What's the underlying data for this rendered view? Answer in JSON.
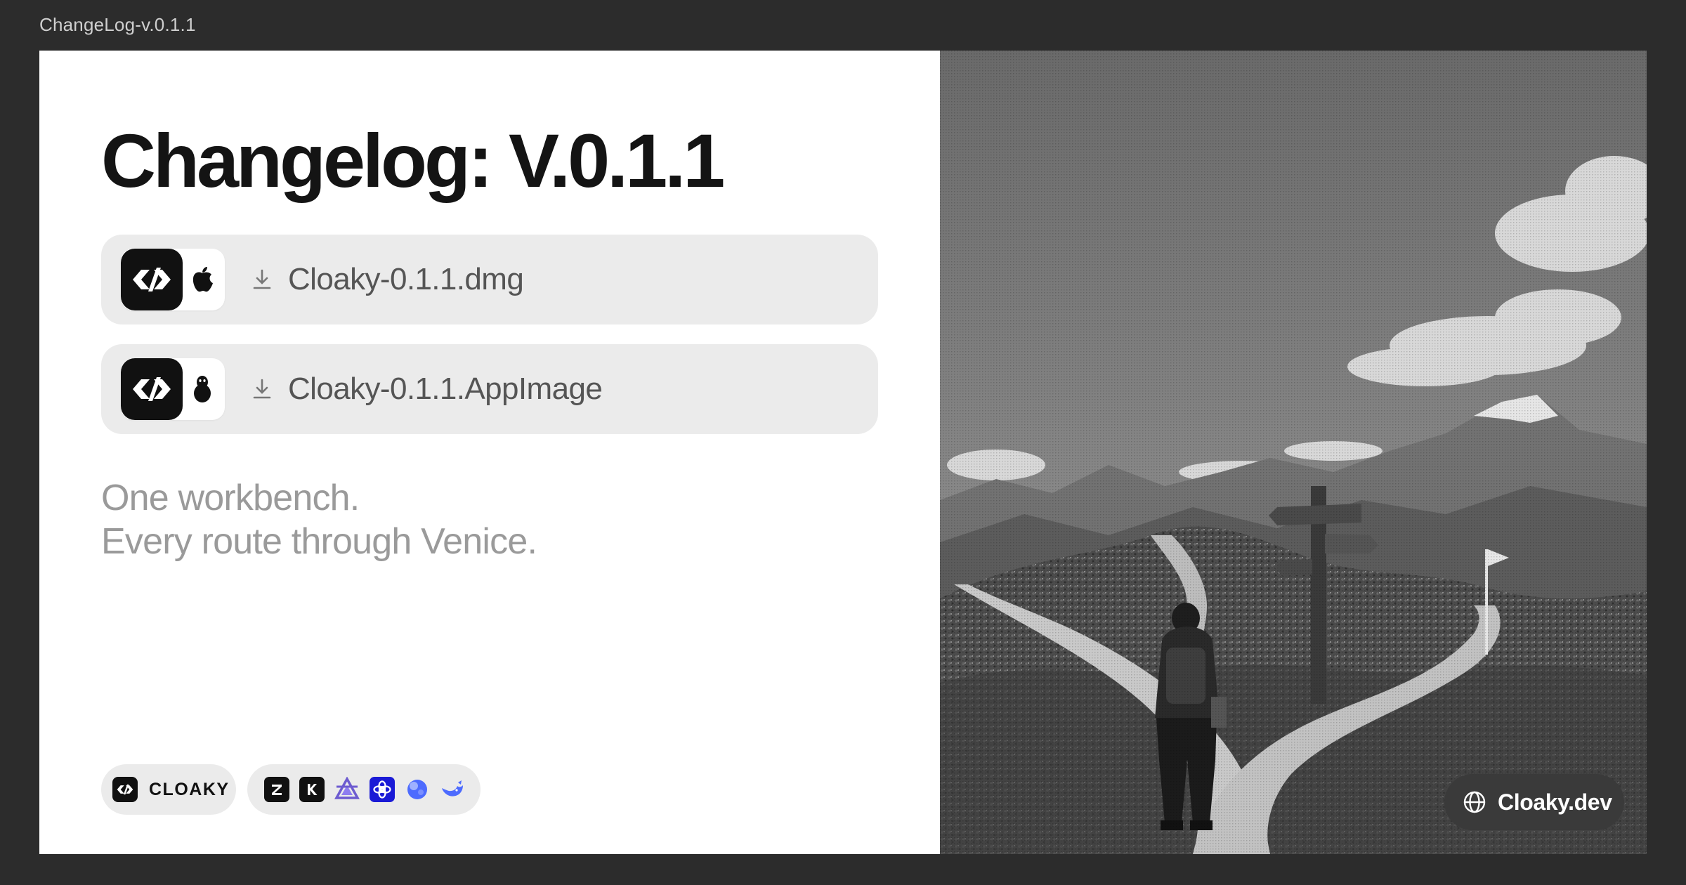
{
  "window": {
    "title": "ChangeLog-v.0.1.1"
  },
  "hero": {
    "title": "Changelog: V.0.1.1"
  },
  "downloads": [
    {
      "os_icon": "apple-icon",
      "file": "Cloaky-0.1.1.dmg"
    },
    {
      "os_icon": "linux-icon",
      "file": "Cloaky-0.1.1.AppImage"
    }
  ],
  "tagline": {
    "line1": "One workbench.",
    "line2": "Every route through Venice."
  },
  "brand": {
    "name": "CLOAKY",
    "icon": "cloaky-logo-icon"
  },
  "providers": [
    {
      "icon": "z-provider-icon",
      "label": "Z",
      "color": "#111111"
    },
    {
      "icon": "k-provider-icon",
      "label": "K",
      "color": "#111111"
    },
    {
      "icon": "triangle-provider-icon",
      "color": "#6d5bd0"
    },
    {
      "icon": "openai-icon",
      "color": "#1a1ad6"
    },
    {
      "icon": "blob-provider-icon",
      "color": "#4d6bfe"
    },
    {
      "icon": "deepseek-whale-icon",
      "color": "#4d6bfe"
    }
  ],
  "illustration": {
    "subject": "hiker-at-crossroads-image"
  },
  "site": {
    "label": "Cloaky.dev",
    "icon": "globe-icon"
  }
}
